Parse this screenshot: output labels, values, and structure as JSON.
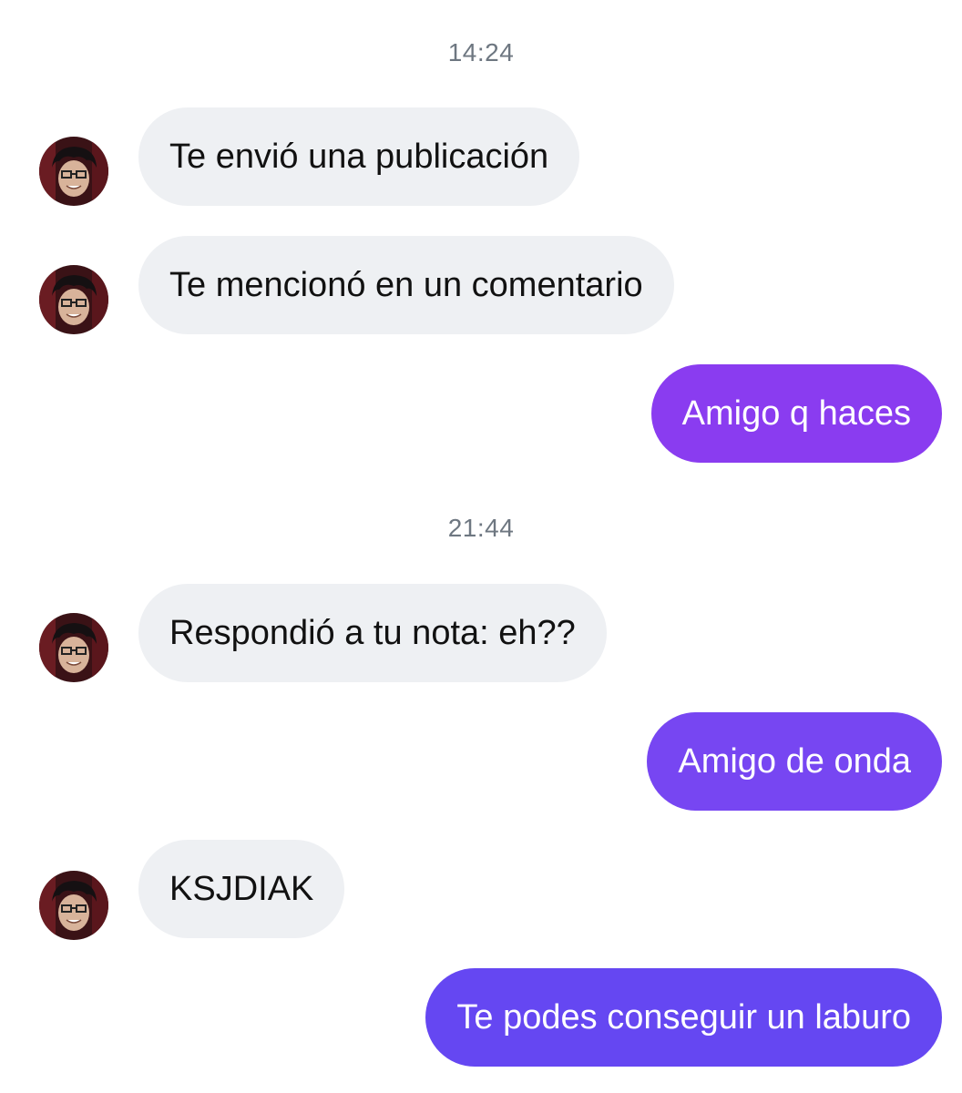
{
  "conversation": {
    "time_1": "14:24",
    "time_2": "21:44",
    "messages": [
      {
        "direction": "incoming",
        "text": "Te envió una publicación"
      },
      {
        "direction": "incoming",
        "text": "Te mencionó en un comentario"
      },
      {
        "direction": "outgoing",
        "text": "Amigo q haces"
      },
      {
        "direction": "incoming",
        "text": "Respondió a tu nota: eh??"
      },
      {
        "direction": "outgoing",
        "text": "Amigo de onda"
      },
      {
        "direction": "incoming",
        "text": "KSJDIAK"
      },
      {
        "direction": "outgoing",
        "text": "Te podes conseguir un laburo"
      }
    ]
  },
  "contact": {
    "avatar_icon": "profile-photo-icon"
  },
  "colors": {
    "incoming_bubble": "#eef0f3",
    "incoming_text": "#111111",
    "outgoing_bubble_purple": "#8a3cf0",
    "outgoing_bubble_violet": "#7746f2",
    "outgoing_bubble_indigo": "#6547f2",
    "outgoing_text": "#ffffff",
    "timestamp_text": "#6e7781"
  }
}
